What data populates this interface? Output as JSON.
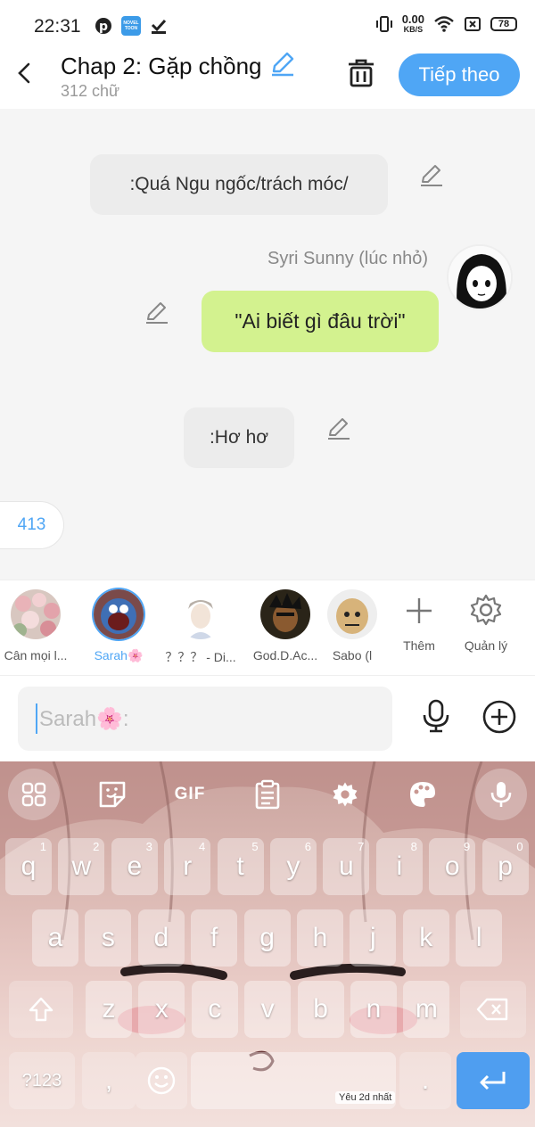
{
  "status": {
    "time": "22:31",
    "net_speed_value": "0.00",
    "net_speed_unit": "KB/S",
    "battery": "78",
    "app_badge_text": "NOVEL TOON"
  },
  "header": {
    "title": "Chap 2: Gặp chồng",
    "subtitle": "312 chữ",
    "next_label": "Tiếp theo"
  },
  "chat": {
    "messages": [
      {
        "type": "narration",
        "text": ":Quá Ngu ngốc/trách móc/"
      },
      {
        "type": "speech",
        "speaker": "Syri Sunny (lúc nhỏ)",
        "text": "\"Ai biết gì đâu trời\""
      },
      {
        "type": "narration",
        "text": ":Hơ hơ"
      }
    ],
    "count": "413"
  },
  "characters": [
    {
      "name": "Cân mọi l...",
      "color": "#c98e93",
      "active": false
    },
    {
      "name": "Sarah🌸",
      "color": "#b85a5a",
      "active": true
    },
    {
      "name": "？？？ - Di...",
      "color": "#e8dcd0",
      "active": false
    },
    {
      "name": "God.D.Ac...",
      "color": "#3a2e1e",
      "active": false
    },
    {
      "name": "Sabo (l",
      "color": "#c7b48f",
      "active": false
    }
  ],
  "tools": {
    "add_label": "Thêm",
    "manage_label": "Quản lý"
  },
  "input": {
    "placeholder": "Sarah🌸:"
  },
  "keyboard": {
    "row1": [
      {
        "k": "q",
        "h": "1"
      },
      {
        "k": "w",
        "h": "2"
      },
      {
        "k": "e",
        "h": "3"
      },
      {
        "k": "r",
        "h": "4"
      },
      {
        "k": "t",
        "h": "5"
      },
      {
        "k": "y",
        "h": "6"
      },
      {
        "k": "u",
        "h": "7"
      },
      {
        "k": "i",
        "h": "8"
      },
      {
        "k": "o",
        "h": "9"
      },
      {
        "k": "p",
        "h": "0"
      }
    ],
    "row2": [
      "a",
      "s",
      "d",
      "f",
      "g",
      "h",
      "j",
      "k",
      "l"
    ],
    "row3": [
      "z",
      "x",
      "c",
      "v",
      "b",
      "n",
      "m"
    ],
    "symbols_label": "?123",
    "comma": ",",
    "period": ".",
    "gif_label": "GIF",
    "space_tag": "Yêu 2d nhất"
  },
  "colors": {
    "accent": "#4fa6f5",
    "speech_bubble": "#d3f28f",
    "narration_bubble": "#ececec"
  }
}
